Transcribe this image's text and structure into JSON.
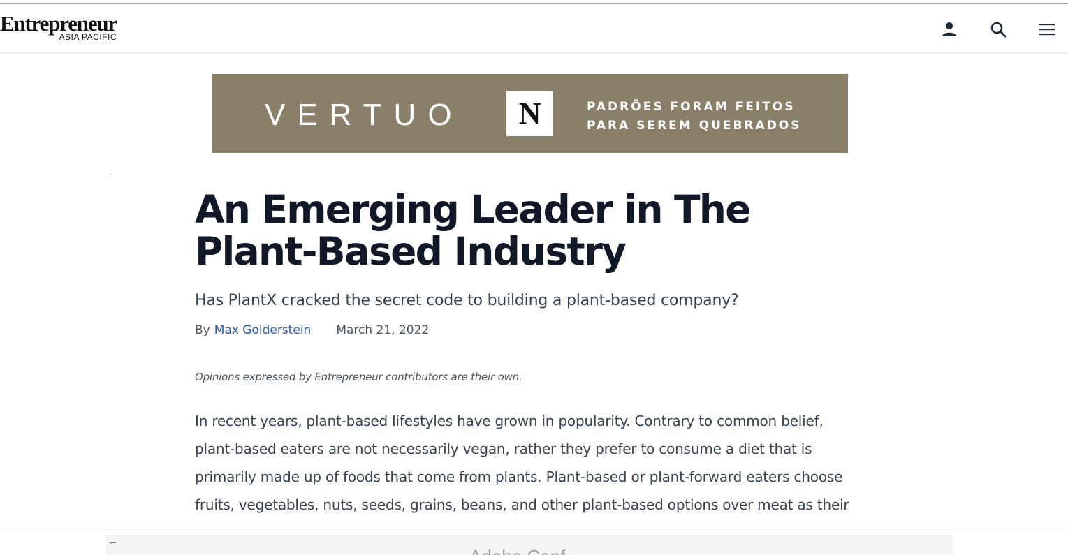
{
  "header": {
    "logo_main": "Entrepreneur",
    "logo_sub": "ASIA PACIFIC",
    "icons": [
      "user-icon",
      "search-icon",
      "menu-icon"
    ]
  },
  "ad": {
    "brand": "VERTUO",
    "logo_letter": "N",
    "tagline_line1": "PADRÕES FORAM FEITOS",
    "tagline_line2": "PARA SEREM QUEBRADOS",
    "background": "#8a7f69"
  },
  "article": {
    "title": "An Emerging Leader in The Plant-Based Industry",
    "subtitle": "Has PlantX cracked the secret code to building a plant-based company?",
    "by_label": "By",
    "author": "Max Golderstein",
    "date": "March 21, 2022",
    "disclaimer": "Opinions expressed by Entrepreneur contributors are their own.",
    "body": "In recent years, plant-based lifestyles have grown in popularity. Contrary to common belief, plant-based eaters are not necessarily vegan, rather they prefer to consume a diet that is primarily made up of foods that come from plants. Plant-based or plant-forward eaters choose fruits, vegetables, nuts, seeds, grains, beans, and other plant-based options over meat as their"
  },
  "bottom_ad": {
    "text": "Adobe Conf..."
  },
  "colors": {
    "link": "#2b5aa8",
    "title": "#111827"
  }
}
